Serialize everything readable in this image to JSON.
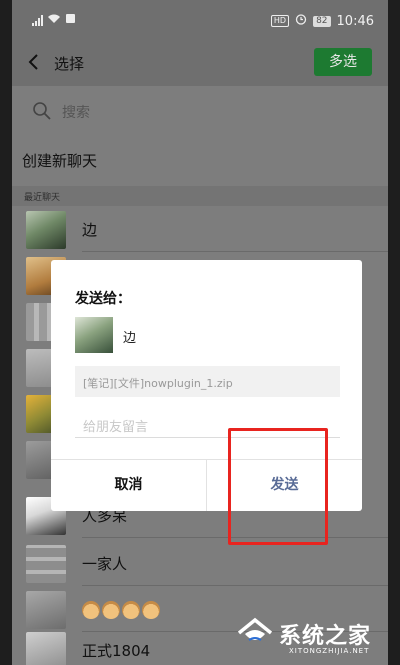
{
  "statusbar": {
    "hd": "HD",
    "battery": "82",
    "time": "10:46"
  },
  "header": {
    "title": "选择",
    "multi_select_label": "多选"
  },
  "search": {
    "placeholder": "搜索"
  },
  "create_chat_label": "创建新聊天",
  "recent_section_label": "最近聊天",
  "chats": [
    {
      "name": "边"
    },
    {
      "name": ""
    },
    {
      "name": ""
    },
    {
      "name": ""
    },
    {
      "name": ""
    },
    {
      "name": ""
    },
    {
      "name": "人多呆"
    },
    {
      "name": "一家人"
    },
    {
      "name": ""
    },
    {
      "name": "正式1804"
    }
  ],
  "dialog": {
    "title": "发送给：",
    "recipient_name": "边",
    "file_text": "[笔记][文件]nowplugin_1.zip",
    "message_placeholder": "给朋友留言",
    "cancel_label": "取消",
    "send_label": "发送"
  },
  "watermark": {
    "name": "系统之家",
    "url": "XITONGZHIJIA.NET"
  },
  "colors": {
    "accent_green": "#1d7a31",
    "send_blue": "#586b96",
    "highlight_red": "#e8241f"
  }
}
